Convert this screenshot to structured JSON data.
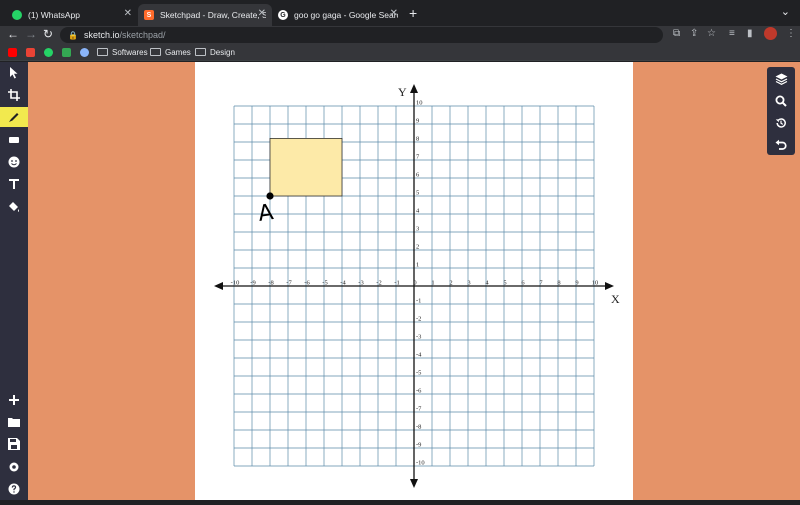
{
  "browser": {
    "tabs": [
      {
        "title": "(1) WhatsApp",
        "active": false,
        "favicon": "whatsapp-icon",
        "color": "#25d366"
      },
      {
        "title": "Sketchpad - Draw, Create, Sha",
        "active": true,
        "favicon": "sketchpad-icon",
        "color": "#ff6b2b"
      },
      {
        "title": "goo go gaga - Google Search",
        "active": false,
        "favicon": "google-icon",
        "color": "#ffffff"
      }
    ],
    "url_host": "sketch.io",
    "url_path": "/sketchpad/",
    "bookmarks": [
      {
        "label": "Softwares"
      },
      {
        "label": "Games"
      },
      {
        "label": "Design"
      }
    ]
  },
  "app": {
    "left_tools": [
      "select-tool",
      "crop-tool",
      "brush-tool",
      "eraser-tool",
      "sticker-tool",
      "text-tool",
      "fill-tool",
      "add-tool",
      "open-tool",
      "save-tool",
      "settings-tool",
      "help-tool"
    ],
    "active_tool": "brush-tool",
    "right_tools": [
      "layers-tool",
      "zoom-tool",
      "history-tool",
      "undo-tool"
    ],
    "colors": {
      "sidebar": "#2e2f3e",
      "background": "#e59368",
      "active_tool": "#f2e94e",
      "grid": "#5a8aa8",
      "rect_fill": "#fdeaa8"
    }
  },
  "graph": {
    "x_label": "X",
    "y_label": "Y",
    "xlim": [
      -10,
      10
    ],
    "ylim": [
      -10,
      10
    ],
    "x_ticks": [
      -10,
      -9,
      -8,
      -7,
      -6,
      -5,
      -4,
      -3,
      -2,
      -1,
      0,
      1,
      2,
      3,
      4,
      5,
      6,
      7,
      8,
      9,
      10
    ],
    "y_ticks": [
      -10,
      -9,
      -8,
      -7,
      -6,
      -5,
      -4,
      -3,
      -2,
      -1,
      1,
      2,
      3,
      4,
      5,
      6,
      7,
      8,
      9,
      10
    ],
    "shapes": {
      "rectangle": {
        "x1": -8,
        "x2": -4,
        "y1": 5,
        "y2": 8.2
      },
      "point": {
        "label": "A",
        "x": -8,
        "y": 5
      }
    }
  }
}
